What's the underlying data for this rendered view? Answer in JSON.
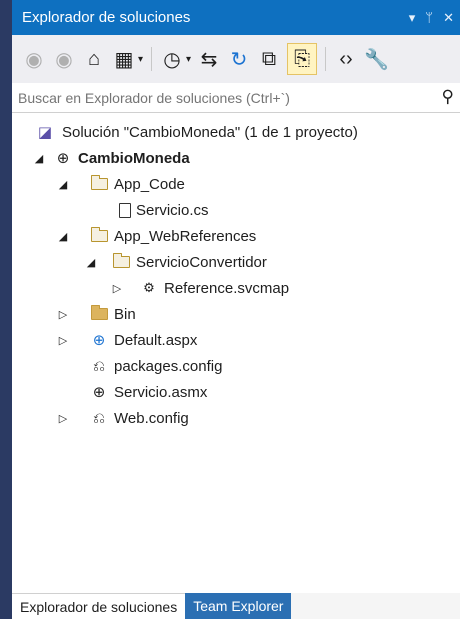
{
  "window": {
    "title": "Explorador de soluciones",
    "controls": [
      "▾",
      "ᛘ",
      "✕"
    ]
  },
  "toolbar": {
    "buttons": [
      {
        "icon": "back-icon",
        "glyph": "◉"
      },
      {
        "icon": "forward-icon",
        "glyph": "◉"
      },
      {
        "icon": "home-icon",
        "glyph": "⌂"
      },
      {
        "icon": "switch-views-icon",
        "glyph": "▦"
      },
      {
        "icon": "pending-changes-icon",
        "glyph": "◷"
      },
      {
        "icon": "sync-icon",
        "glyph": "⇆"
      },
      {
        "icon": "refresh-icon",
        "glyph": "↻"
      },
      {
        "icon": "collapse-all-icon",
        "glyph": "⧉"
      },
      {
        "icon": "show-all-files-icon",
        "glyph": "⎘"
      },
      {
        "icon": "view-code-icon",
        "glyph": "‹›"
      },
      {
        "icon": "properties-wrench-icon",
        "glyph": "🔧"
      }
    ],
    "caret": "▾"
  },
  "search": {
    "placeholder": "Buscar en Explorador de soluciones (Ctrl+`)",
    "icon_glyph": "⚲"
  },
  "tree": {
    "expanded_glyph": "◢",
    "collapsed_glyph": "▷",
    "items": [
      {
        "label": "Solución \"CambioMoneda\" (1 de 1 proyecto)",
        "icon": "solution-icon",
        "glyph": "◪"
      },
      {
        "label": "CambioMoneda",
        "icon": "website-globe-icon",
        "glyph": "⊕"
      },
      {
        "label": "App_Code",
        "icon": "folder-icon"
      },
      {
        "label": "Servicio.cs",
        "icon": "cs-file-icon"
      },
      {
        "label": "App_WebReferences",
        "icon": "folder-icon"
      },
      {
        "label": "ServicioConvertidor",
        "icon": "folder-icon"
      },
      {
        "label": "Reference.svcmap",
        "icon": "svcmap-file-icon",
        "glyph": "⚙"
      },
      {
        "label": "Bin",
        "icon": "folder-filled-icon"
      },
      {
        "label": "Default.aspx",
        "icon": "aspx-file-icon",
        "glyph": "⊕"
      },
      {
        "label": "packages.config",
        "icon": "config-file-icon",
        "glyph": "⎌"
      },
      {
        "label": "Servicio.asmx",
        "icon": "asmx-file-icon",
        "glyph": "⊕"
      },
      {
        "label": "Web.config",
        "icon": "config-file-icon",
        "glyph": "⎌"
      }
    ]
  },
  "tabs": [
    {
      "label": "Explorador de soluciones",
      "active": true
    },
    {
      "label": "Team Explorer",
      "active": false
    }
  ]
}
